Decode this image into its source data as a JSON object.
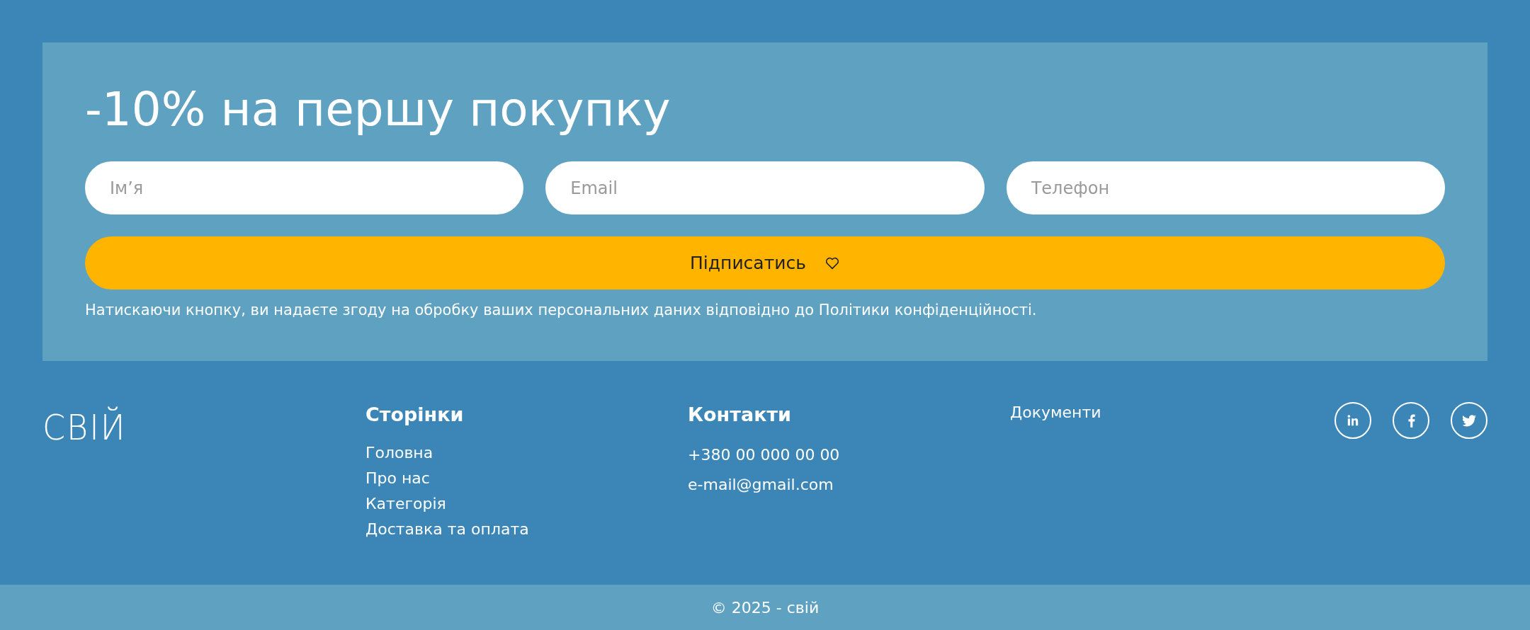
{
  "promo": {
    "title": "-10% на першу покупку",
    "fields": [
      {
        "placeholder": "Ім’я"
      },
      {
        "placeholder": "Email"
      },
      {
        "placeholder": "Телефон"
      }
    ],
    "button": "Підписатись",
    "consent": "Натискаючи кнопку, ви надаєте згоду на обробку ваших персональних даних відповідно до Політики конфіденційності."
  },
  "footer": {
    "logo": "СВІЙ",
    "pages": {
      "title": "Сторінки",
      "links": [
        "Головна",
        "Про нас",
        "Категорія",
        "Доставка та оплата"
      ]
    },
    "contacts": {
      "title": "Контакти",
      "items": [
        "+380 00 000 00 00",
        "e-mail@gmail.com"
      ]
    },
    "documents": "Документи",
    "socials": [
      {
        "kind": "linkedin"
      },
      {
        "kind": "facebook"
      },
      {
        "kind": "twitter"
      }
    ]
  },
  "copyright": "© 2025 - свій"
}
